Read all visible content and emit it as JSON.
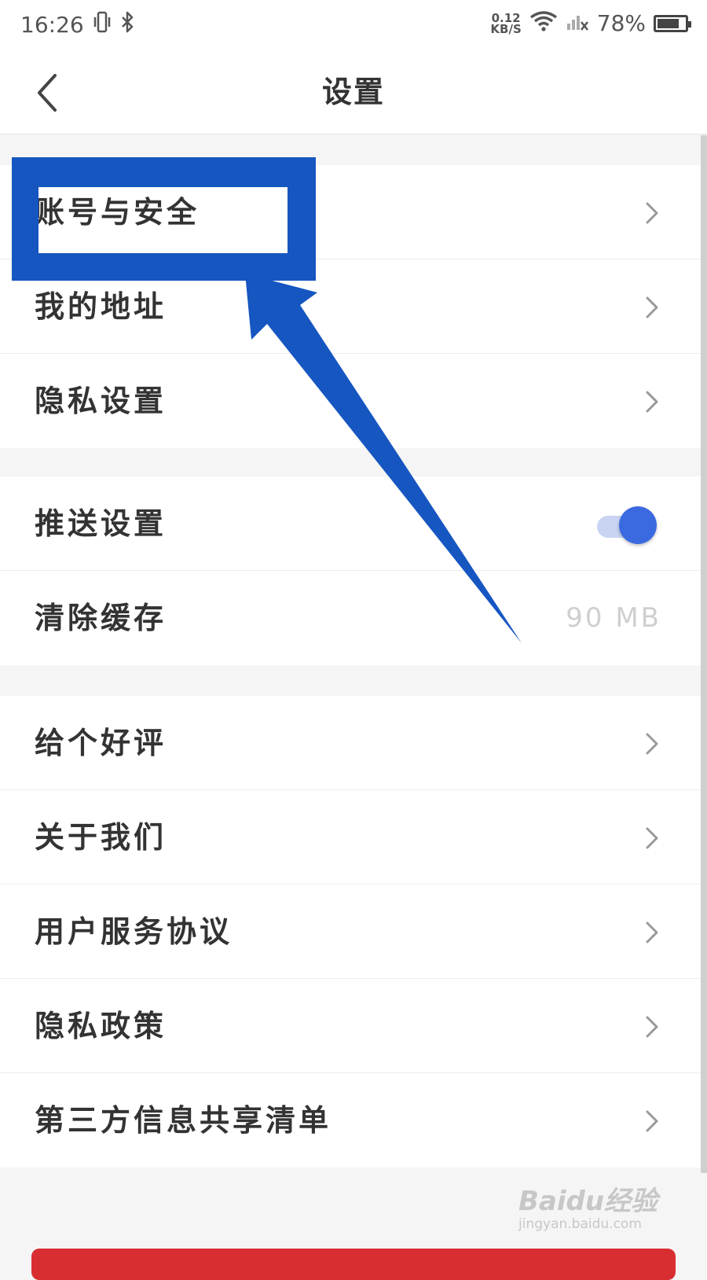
{
  "status_bar": {
    "time": "16:26",
    "net_speed_value": "0.12",
    "net_speed_unit": "KB/S",
    "battery_percent": "78%",
    "battery_level": 0.78,
    "icons": [
      "vibrate-icon",
      "bluetooth-icon",
      "wifi-icon",
      "signal-no-service-icon",
      "battery-icon"
    ]
  },
  "header": {
    "title": "设置",
    "back_icon": "chevron-left-icon"
  },
  "groups": [
    {
      "items": [
        {
          "label": "账号与安全",
          "type": "link"
        },
        {
          "label": "我的地址",
          "type": "link"
        },
        {
          "label": "隐私设置",
          "type": "link"
        }
      ]
    },
    {
      "items": [
        {
          "label": "推送设置",
          "type": "toggle",
          "on": true
        },
        {
          "label": "清除缓存",
          "type": "value",
          "value": "90 MB"
        }
      ]
    },
    {
      "items": [
        {
          "label": "给个好评",
          "type": "link"
        },
        {
          "label": "关于我们",
          "type": "link"
        },
        {
          "label": "用户服务协议",
          "type": "link"
        },
        {
          "label": "隐私政策",
          "type": "link"
        },
        {
          "label": "第三方信息共享清单",
          "type": "link"
        }
      ]
    }
  ],
  "colors": {
    "toggle_on": "#3b6ae0",
    "annotation": "#1656c1",
    "bottom_button": "#d92e31"
  },
  "annotation": {
    "target": "账号与安全",
    "shapes": [
      "highlight-box",
      "pointer-arrow"
    ]
  },
  "watermark": {
    "logo": "Baidu经验",
    "url": "jingyan.baidu.com"
  }
}
